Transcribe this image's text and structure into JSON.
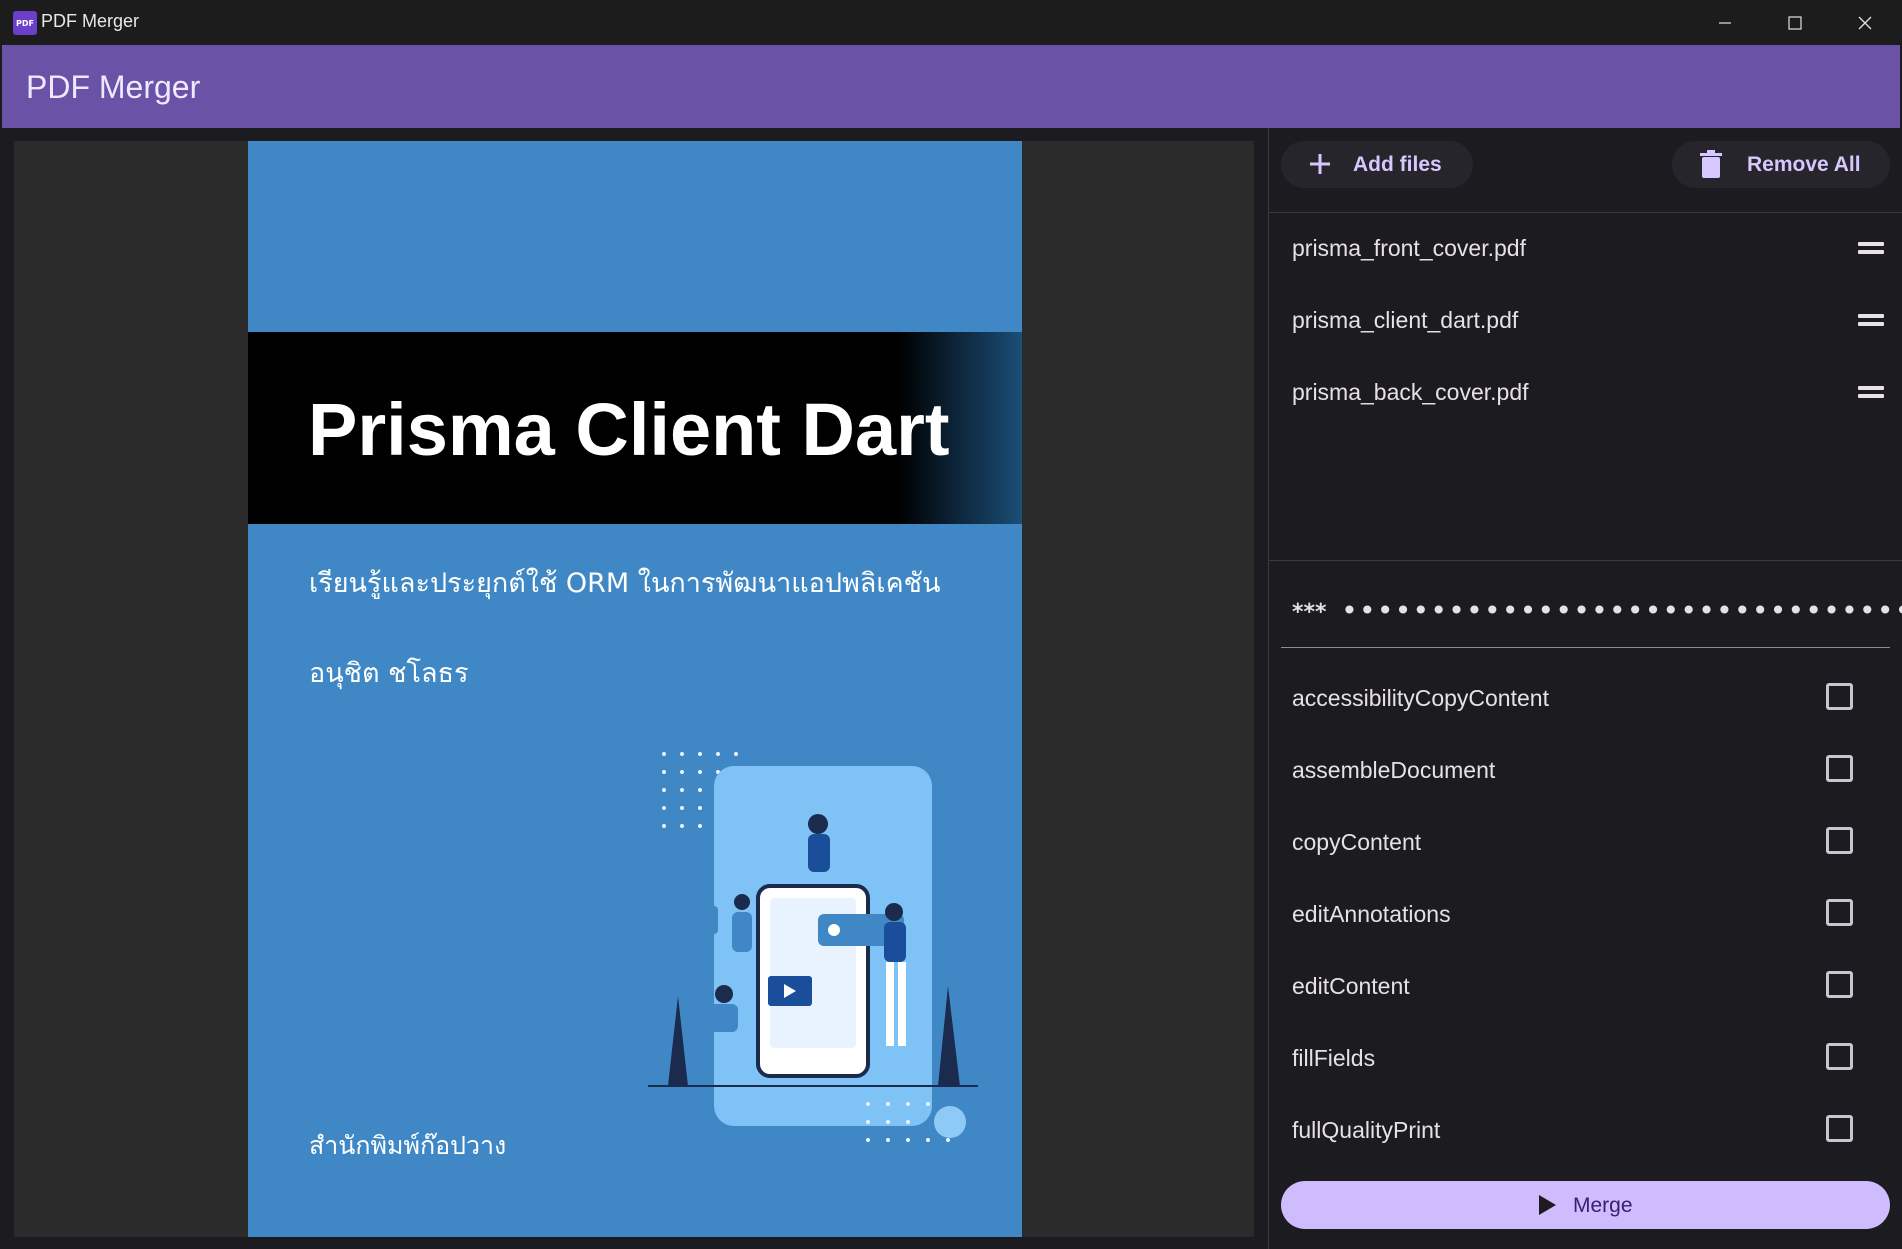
{
  "window": {
    "title": "PDF Merger",
    "icon_label": "PDF"
  },
  "appbar": {
    "title": "PDF Merger"
  },
  "preview": {
    "page_title": "Prisma Client Dart",
    "page_subtitle": "เรียนรู้และประยุกต์ใช้ ORM ในการพัฒนาแอปพลิเคชัน",
    "page_author": "อนุชิต ชโลธร",
    "page_publisher": "สำนักพิมพ์ก๊อปวาง"
  },
  "toolbar": {
    "add_label": "Add files",
    "add_icon": "plus-icon",
    "remove_label": "Remove All",
    "remove_icon": "trash-icon"
  },
  "files": [
    {
      "name": "prisma_front_cover.pdf"
    },
    {
      "name": "prisma_client_dart.pdf"
    },
    {
      "name": "prisma_back_cover.pdf"
    }
  ],
  "password": {
    "icon": "password-icon",
    "icon_text": "***",
    "value": "•••••••••••••••••••••••••••••••••"
  },
  "permissions": [
    {
      "name": "accessibilityCopyContent",
      "checked": false
    },
    {
      "name": "assembleDocument",
      "checked": false
    },
    {
      "name": "copyContent",
      "checked": false
    },
    {
      "name": "editAnnotations",
      "checked": false
    },
    {
      "name": "editContent",
      "checked": false
    },
    {
      "name": "fillFields",
      "checked": false
    },
    {
      "name": "fullQualityPrint",
      "checked": false
    }
  ],
  "merge": {
    "label": "Merge",
    "icon": "play-icon"
  },
  "colors": {
    "accent": "#6a52a7",
    "button_primary": "#cfbcff",
    "page_blue": "#3f88c5"
  }
}
